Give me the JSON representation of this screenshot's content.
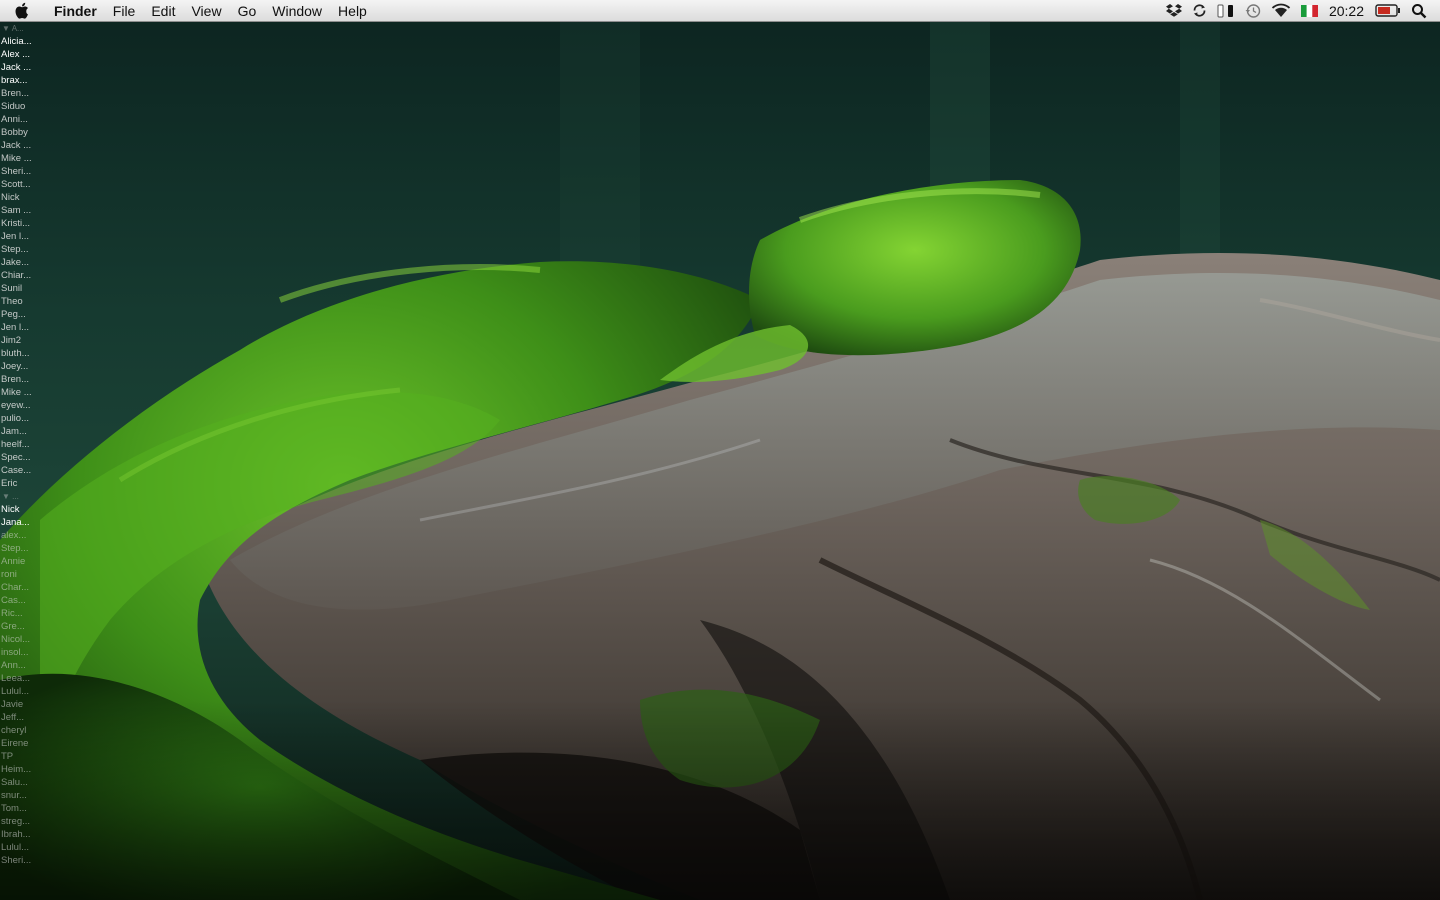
{
  "menubar": {
    "app_name": "Finder",
    "menus": [
      "File",
      "Edit",
      "View",
      "Go",
      "Window",
      "Help"
    ],
    "clock": "20:22",
    "status_icons": [
      "dropbox-icon",
      "sync-icon",
      "battery-small-icon",
      "time-machine-icon",
      "wifi-icon",
      "italy-flag-icon",
      "battery-icon",
      "spotlight-icon"
    ]
  },
  "contacts": {
    "group1_label": "▼ A...",
    "group1": [
      "Alicia...",
      "Alex ...",
      "Jack ...",
      "brax...",
      "Bren...",
      "Siduo",
      "Anni...",
      "Bobby",
      "Jack ...",
      "Mike ...",
      "Sheri...",
      "Scott...",
      "Nick",
      "Sam ...",
      "Kristi...",
      "Jen l...",
      "Step...",
      "Jake...",
      "Chiar...",
      "Sunil",
      "Theo",
      "Peg...",
      "Jen l...",
      "Jim2",
      "bluth...",
      "Joey...",
      "Bren...",
      "Mike ...",
      "eyew...",
      "pulio...",
      "Jam...",
      "heelf...",
      "Spec...",
      "Case...",
      "Eric"
    ],
    "group2_label": "▼ ...",
    "group2": [
      "Nick",
      "Jana...",
      "alex...",
      "Step...",
      "Annie",
      "roni",
      "Char...",
      "Cas...",
      "Ric...",
      "Gre...",
      "Nicol...",
      "insol...",
      "Ann...",
      "Leea...",
      "Lulul...",
      "Javie",
      "Jeff...",
      "cheryl",
      "Eirene",
      "TP",
      "Heim...",
      "Salu...",
      "snur...",
      "Tom...",
      "streg...",
      "Ibrah...",
      "Lulul...",
      "Sheri..."
    ]
  },
  "colors": {
    "menubar_top": "#f4f4f4",
    "menubar_bottom": "#dcdcdc",
    "wallpaper_bg": "#0f2a22",
    "moss": "#3f8f1a",
    "wood": "#6b625a"
  }
}
